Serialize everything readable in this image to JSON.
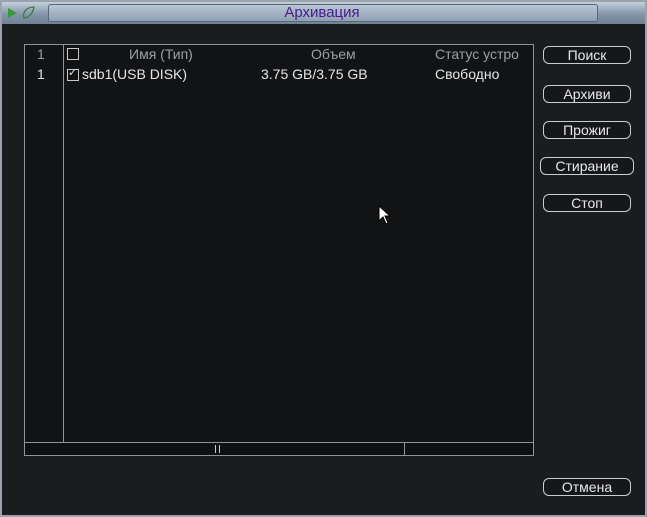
{
  "window": {
    "title": "Архивация"
  },
  "table": {
    "header": {
      "index": "1",
      "name": "Имя (Тип)",
      "size": "Объем",
      "status": "Статус устро"
    },
    "rows": [
      {
        "index": "1",
        "checked": true,
        "name": "sdb1(USB DISK)",
        "size": "3.75 GB/3.75 GB",
        "status": "Свободно"
      }
    ]
  },
  "buttons": {
    "search": "Поиск",
    "archive": "Архиви",
    "burn": "Прожиг",
    "erase": "Стирание",
    "stop": "Стоп",
    "cancel": "Отмена"
  },
  "icons": {
    "title_left": "play-arrow-icon",
    "title_right": "leaf-icon",
    "cursor": "mouse-pointer-icon"
  },
  "colors": {
    "title_text": "#4a1a8a",
    "title_bar": "#8496aa",
    "background": "#1a1c1e"
  }
}
